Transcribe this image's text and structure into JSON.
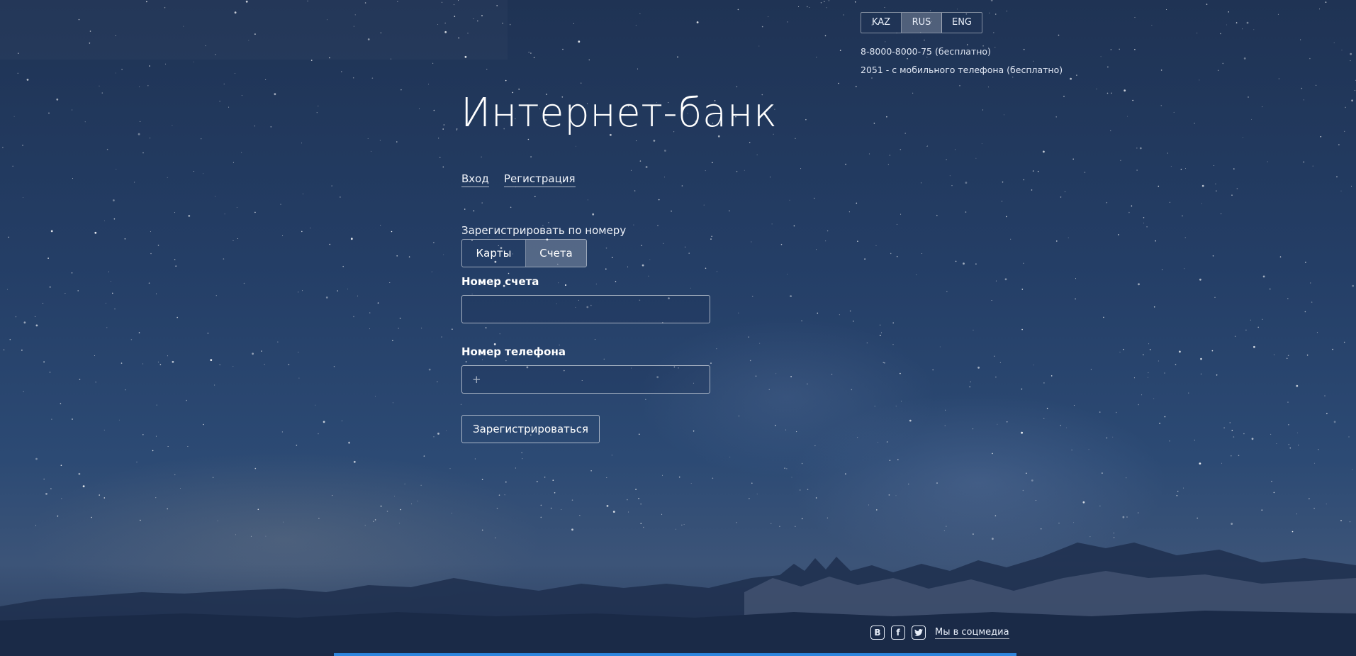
{
  "languages": [
    {
      "code": "KAZ",
      "active": false
    },
    {
      "code": "RUS",
      "active": true
    },
    {
      "code": "ENG",
      "active": false
    }
  ],
  "contacts": {
    "phone1": "8-8000-8000-75 (бесплатно)",
    "phone2": "2051 - с мобильного телефона (бесплатно)"
  },
  "page_title": "Интернет-банк",
  "nav": {
    "login": "Вход",
    "register": "Регистрация"
  },
  "form": {
    "register_by_label": "Зарегистрировать по номеру",
    "toggle": {
      "cards": "Карты",
      "accounts": "Счета",
      "selected": "accounts"
    },
    "account_number": {
      "label": "Номер счета",
      "value": "",
      "placeholder": ""
    },
    "phone_number": {
      "label": "Номер телефона",
      "value": "",
      "placeholder": "+"
    },
    "submit_label": "Зарегистрироваться"
  },
  "footer": {
    "social_text": "Мы в соцмедиа",
    "social_icons": [
      "vk-icon",
      "facebook-icon",
      "twitter-icon"
    ]
  },
  "colors": {
    "background": "#243e66",
    "accent_bar": "#2e86de"
  }
}
